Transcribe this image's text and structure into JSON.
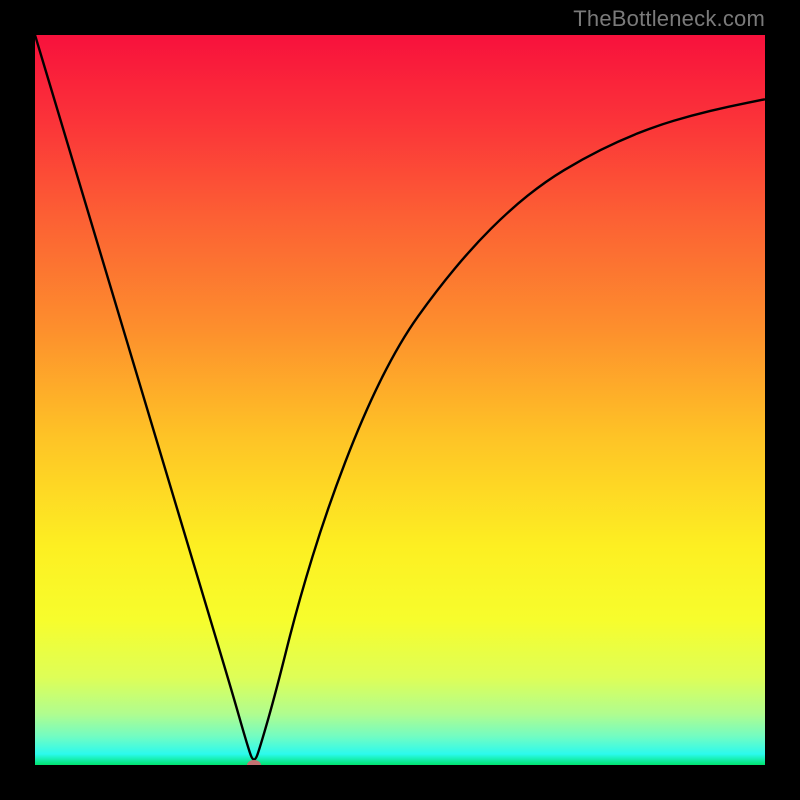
{
  "watermark": "TheBottleneck.com",
  "chart_data": {
    "type": "line",
    "title": "",
    "xlabel": "",
    "ylabel": "",
    "xlim": [
      0,
      100
    ],
    "ylim": [
      0,
      100
    ],
    "grid": false,
    "x": [
      0,
      3,
      6,
      9,
      12,
      15,
      18,
      21,
      24,
      27,
      29,
      30,
      31,
      33,
      36,
      40,
      45,
      50,
      55,
      60,
      65,
      70,
      75,
      80,
      85,
      90,
      95,
      100
    ],
    "y": [
      100,
      90,
      80,
      70,
      60,
      50,
      40,
      30,
      20,
      10,
      3,
      0,
      3,
      10,
      22,
      35,
      48,
      58,
      65,
      71,
      76,
      80,
      83,
      85.5,
      87.5,
      89,
      90.2,
      91.2
    ],
    "minimum_marker": {
      "x": 30,
      "y": 0
    },
    "background_gradient": {
      "stops": [
        {
          "pos": 0.0,
          "color": "#f8113c"
        },
        {
          "pos": 0.12,
          "color": "#fb3439"
        },
        {
          "pos": 0.25,
          "color": "#fc6034"
        },
        {
          "pos": 0.4,
          "color": "#fd8e2d"
        },
        {
          "pos": 0.55,
          "color": "#fec326"
        },
        {
          "pos": 0.7,
          "color": "#fdef22"
        },
        {
          "pos": 0.8,
          "color": "#f7fd2c"
        },
        {
          "pos": 0.88,
          "color": "#defe57"
        },
        {
          "pos": 0.93,
          "color": "#b0fd8f"
        },
        {
          "pos": 0.96,
          "color": "#74fcc1"
        },
        {
          "pos": 0.985,
          "color": "#2cfaed"
        },
        {
          "pos": 1.0,
          "color": "#00e36f"
        }
      ]
    }
  }
}
